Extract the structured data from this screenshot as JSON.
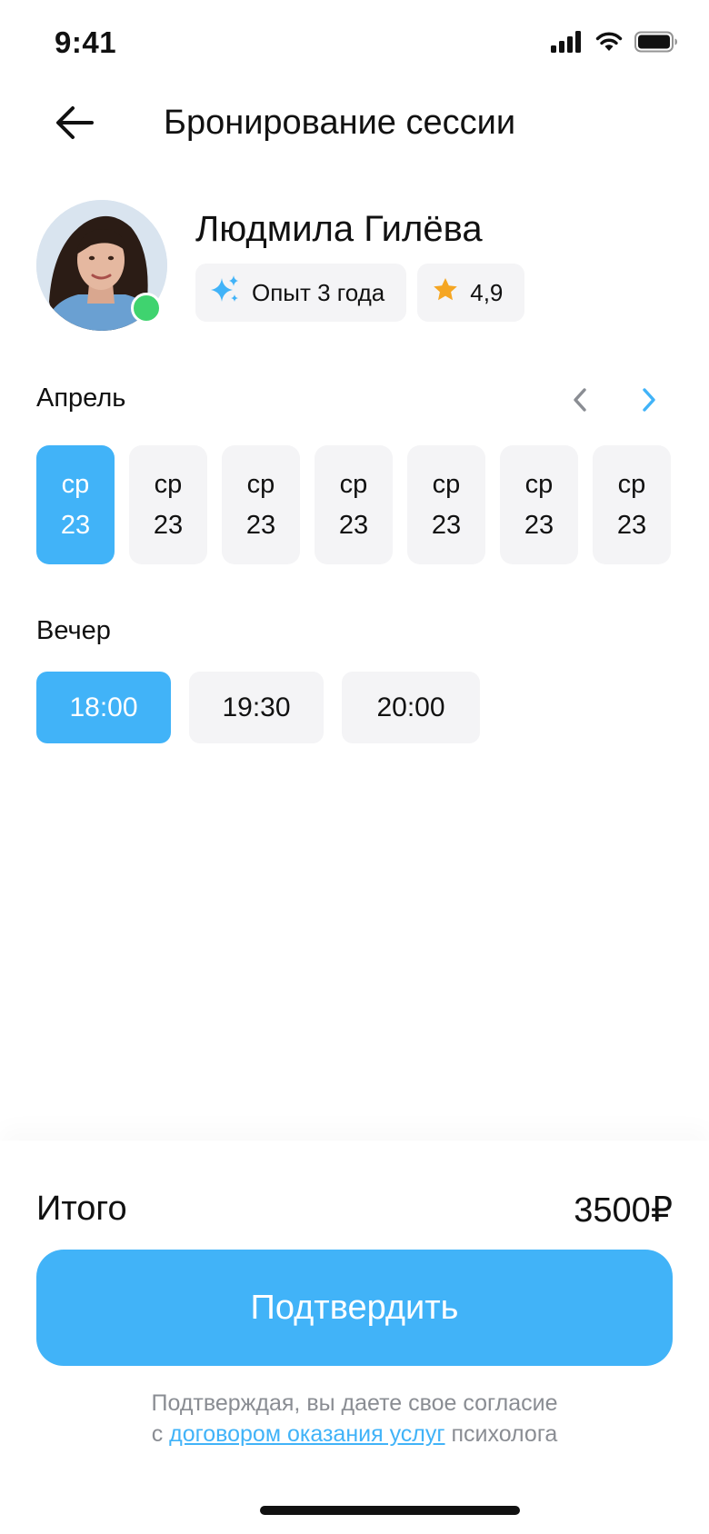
{
  "status_bar": {
    "time": "9:41",
    "icons": [
      "signal-icon",
      "wifi-icon",
      "battery-icon"
    ]
  },
  "nav": {
    "back_icon": "arrow-left-icon",
    "title": "Бронирование сессии"
  },
  "psychologist": {
    "name": "Людмила Гилёва",
    "online": true,
    "experience": {
      "icon": "sparkles-icon",
      "label": "Опыт 3 года"
    },
    "rating": {
      "icon": "star-icon",
      "label": "4,9"
    }
  },
  "calendar": {
    "month": "Апрель",
    "prev_icon": "chevron-left-icon",
    "next_icon": "chevron-right-icon",
    "days": [
      {
        "weekday": "ср",
        "day": "23",
        "selected": true
      },
      {
        "weekday": "ср",
        "day": "23",
        "selected": false
      },
      {
        "weekday": "ср",
        "day": "23",
        "selected": false
      },
      {
        "weekday": "ср",
        "day": "23",
        "selected": false
      },
      {
        "weekday": "ср",
        "day": "23",
        "selected": false
      },
      {
        "weekday": "ср",
        "day": "23",
        "selected": false
      },
      {
        "weekday": "ср",
        "day": "23",
        "selected": false
      }
    ]
  },
  "time_section": {
    "label": "Вечер",
    "slots": [
      {
        "time": "18:00",
        "selected": true
      },
      {
        "time": "19:30",
        "selected": false
      },
      {
        "time": "20:00",
        "selected": false
      }
    ]
  },
  "summary": {
    "total_label": "Итого",
    "total_value": "3500₽"
  },
  "confirm_button": "Подтвердить",
  "consent": {
    "line1": "Подтверждая, вы даете свое согласие",
    "prefix": "с",
    "link": "договором оказания услуг",
    "suffix": "психолога"
  },
  "colors": {
    "accent": "#41b3f8",
    "chip_bg": "#f4f4f6",
    "online": "#3fd36f",
    "star": "#f5a623",
    "muted_text": "#8a8d93"
  }
}
